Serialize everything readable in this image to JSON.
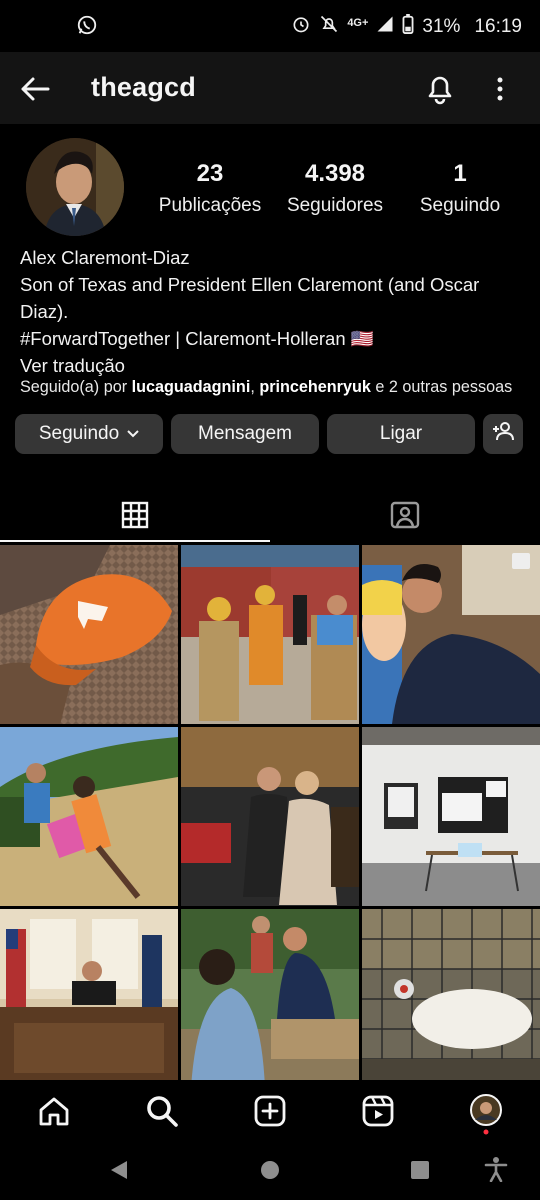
{
  "status_bar": {
    "battery": "31%",
    "time": "16:19",
    "network": "4G+",
    "icons": [
      "whatsapp-icon",
      "alarm-icon",
      "mute-icon",
      "signal-icon",
      "battery-icon"
    ]
  },
  "header": {
    "username": "theagcd",
    "icons": [
      "back-arrow-icon",
      "bell-icon",
      "more-vertical-icon"
    ]
  },
  "profile": {
    "stats": [
      {
        "value": "23",
        "label": "Publicações"
      },
      {
        "value": "4.398",
        "label": "Seguidores"
      },
      {
        "value": "1",
        "label": "Seguindo"
      }
    ],
    "name": "Alex Claremont-Diaz",
    "bio_line1": "Son of Texas and President Ellen Claremont (and Oscar Diaz).",
    "bio_line2": "#ForwardTogether | Claremont-Holleran 🇺🇸",
    "translate": "Ver tradução",
    "followed_prefix": "Seguido(a) por ",
    "followed_user1": "lucaguadagnini",
    "followed_sep": ", ",
    "followed_user2": "princehenryuk",
    "followed_suffix": " e 2 outras pessoas"
  },
  "actions": {
    "following": "Seguindo",
    "message": "Mensagem",
    "call": "Ligar"
  },
  "tabs": {
    "active": "grid",
    "icons": [
      "grid-icon",
      "tagged-icon"
    ]
  },
  "grid": {
    "posts": [
      {
        "subject": "orange cap"
      },
      {
        "subject": "construction workers"
      },
      {
        "subject": "selfie"
      },
      {
        "subject": "couple on lawn"
      },
      {
        "subject": "couple on sofa"
      },
      {
        "subject": "register to vote booth"
      },
      {
        "subject": "oval office"
      },
      {
        "subject": "picnic table"
      },
      {
        "subject": "animal in cage"
      }
    ]
  },
  "bottom_nav": {
    "icons": [
      "home-icon",
      "search-icon",
      "create-icon",
      "reels-icon",
      "profile-avatar"
    ]
  },
  "colors": {
    "background": "#000000",
    "appbar": "#141414",
    "button": "#363636",
    "text": "#f5f5f5",
    "notification_dot": "#ff3040"
  }
}
